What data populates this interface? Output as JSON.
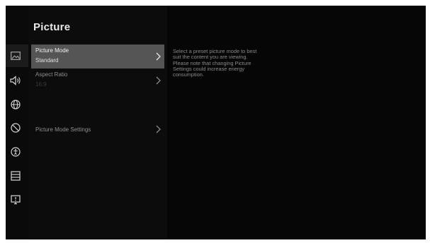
{
  "page": {
    "title": "Picture"
  },
  "sidebar": {
    "icons": [
      {
        "name": "picture-icon",
        "active": true
      },
      {
        "name": "sound-icon",
        "active": false
      },
      {
        "name": "network-icon",
        "active": false
      },
      {
        "name": "privacy-icon",
        "active": false
      },
      {
        "name": "accessibility-icon",
        "active": false
      },
      {
        "name": "system-icon",
        "active": false
      },
      {
        "name": "support-icon",
        "active": false
      }
    ]
  },
  "menu": {
    "items": [
      {
        "label": "Picture Mode",
        "value": "Standard",
        "selected": true
      },
      {
        "label": "Aspect Ratio",
        "value": "16:9",
        "selected": false
      },
      {
        "label": "Picture Mode Settings",
        "selected": false
      }
    ]
  },
  "description": "Select a preset picture mode to best suit the content you are viewing. Please note that changing Picture Settings could increase energy consumption.",
  "colors": {
    "screen_bg": "#060606",
    "selected_bg": "#555555",
    "text_primary": "#f2f2f2",
    "text_muted": "#8f8f8f"
  }
}
